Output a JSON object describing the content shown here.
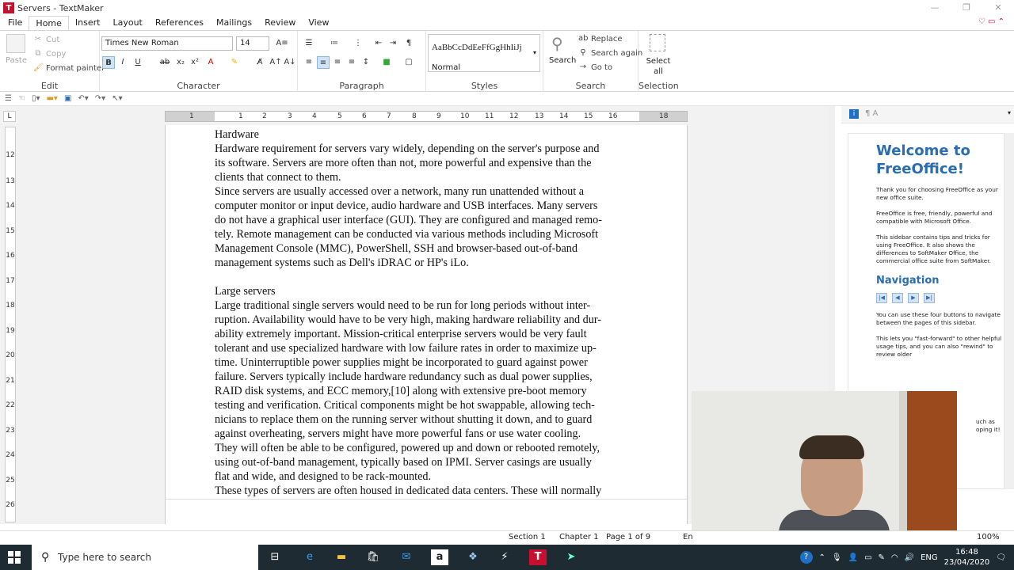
{
  "window": {
    "title": "Servers - TextMaker",
    "logo": "T",
    "controls": [
      "—",
      "❐",
      "✕"
    ]
  },
  "menu": {
    "items": [
      "File",
      "Home",
      "Insert",
      "Layout",
      "References",
      "Mailings",
      "Review",
      "View"
    ],
    "active": "Home"
  },
  "ribbon": {
    "edit": {
      "label": "Edit",
      "paste": "Paste",
      "cut": "Cut",
      "copy": "Copy",
      "format_painter": "Format painter"
    },
    "character": {
      "label": "Character",
      "font": "Times New Roman",
      "size": "14"
    },
    "paragraph": {
      "label": "Paragraph"
    },
    "styles": {
      "label": "Styles",
      "preview": "AaBbCcDdEeFfGgHhIiJj",
      "current": "Normal"
    },
    "search": {
      "label": "Search",
      "search_btn": "Search",
      "replace": "Replace",
      "search_again": "Search again",
      "go_to": "Go to"
    },
    "selection": {
      "label": "Selection",
      "select_all": "Select all"
    }
  },
  "ruler": {
    "h_numbers": [
      "1",
      "1",
      "2",
      "3",
      "4",
      "5",
      "6",
      "7",
      "8",
      "9",
      "10",
      "11",
      "12",
      "13",
      "14",
      "15",
      "16",
      "18"
    ],
    "v_numbers": [
      "12",
      "13",
      "14",
      "15",
      "16",
      "17",
      "18",
      "19",
      "20",
      "21",
      "22",
      "23",
      "24",
      "25",
      "26"
    ]
  },
  "document": {
    "lines": [
      "Hardware",
      "Hardware requirement for servers vary widely, depending on the server's purpose and",
      "its software. Servers are more often than not, more powerful and expensive than the",
      "clients that connect to them.",
      "Since servers are usually accessed over a network, many run unattended without a",
      "computer monitor or input device, audio hardware and USB interfaces. Many servers",
      "do not have a graphical user interface (GUI). They are configured and managed remo-",
      "tely. Remote management can be conducted via various methods including Microsoft",
      "Management Console (MMC), PowerShell, SSH and browser-based out-of-band",
      "management systems such as Dell's iDRAC or HP's iLo.",
      "",
      "Large servers",
      "Large traditional single servers would need to be run for long periods without inter-",
      "ruption. Availability would have to be very high, making hardware reliability and dur-",
      "ability extremely important. Mission-critical enterprise servers would be very fault",
      "tolerant and use specialized hardware with low failure rates in order to maximize up-",
      "time. Uninterruptible power supplies might be incorporated to guard against power",
      "failure. Servers typically include hardware redundancy such as dual power supplies,",
      "RAID disk systems, and ECC memory,[10] along with extensive pre-boot memory",
      "testing and verification. Critical components might be hot swappable, allowing tech-",
      "nicians to replace them on the running server without shutting it down, and to guard",
      "against overheating, servers might have more powerful fans or use water cooling.",
      "They will often be able to be configured, powered up and down or rebooted remotely,",
      "using out-of-band management, typically based on IPMI. Server casings are usually",
      "flat and wide, and designed to be rack-mounted.",
      "These types of servers are often housed in dedicated data centers. These will normally"
    ]
  },
  "sidebar": {
    "title": "Welcome to FreeOffice!",
    "p1": "Thank you for choosing FreeOffice as your new office suite.",
    "p2": "FreeOffice is free, friendly, powerful and compatible with Microsoft Office.",
    "p3": "This sidebar contains tips and tricks for using FreeOffice. It also shows the differences to SoftMaker Office, the commercial office suite from SoftMaker.",
    "nav_title": "Navigation",
    "p4": "You can use these four buttons to navigate between the pages of this sidebar.",
    "p5": "This lets you \"fast-forward\" to other helpful usage tips, and you can also \"rewind\" to review older",
    "p6_right": "uch as",
    "p7_right": "oping it!"
  },
  "status": {
    "section": "Section 1",
    "chapter": "Chapter 1",
    "page": "Page 1 of 9",
    "lang": "En",
    "zoom": "100%"
  },
  "taskbar": {
    "search_placeholder": "Type here to search",
    "lang": "ENG",
    "time": "16:48",
    "date": "23/04/2020"
  }
}
